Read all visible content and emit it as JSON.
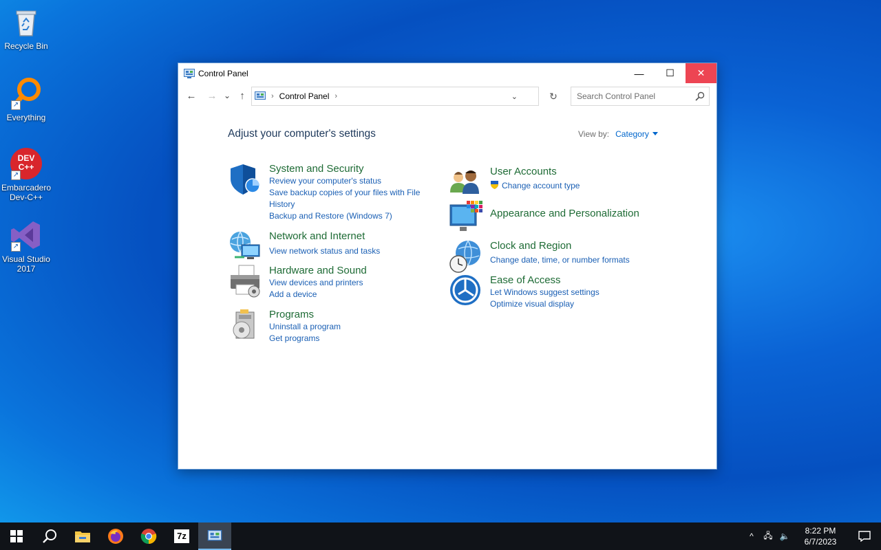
{
  "desktop": {
    "icons": [
      {
        "label": "Recycle Bin"
      },
      {
        "label": "Everything"
      },
      {
        "label": "Embarcadero Dev-C++",
        "badge": "DEV C++"
      },
      {
        "label": "Visual Studio 2017"
      }
    ]
  },
  "window": {
    "title": "Control Panel",
    "controls": {
      "minimize": "—",
      "maximize": "☐",
      "close": "✕"
    },
    "nav": {
      "back": "←",
      "forward": "→",
      "recent": "⌄",
      "up": "↑"
    },
    "address": {
      "crumb": "Control Panel",
      "separator": "›",
      "refresh": "↻",
      "dropdown": "⌄"
    },
    "search": {
      "placeholder": "Search Control Panel"
    },
    "heading": "Adjust your computer's settings",
    "view_by": {
      "label": "View by:",
      "value": "Category"
    },
    "categories": [
      {
        "title": "System and Security",
        "icon": "shield-icon",
        "links": [
          "Review your computer's status",
          "Save backup copies of your files with File History",
          "Backup and Restore (Windows 7)"
        ]
      },
      {
        "title": "Network and Internet",
        "icon": "network-icon",
        "links": [
          "View network status and tasks"
        ]
      },
      {
        "title": "Hardware and Sound",
        "icon": "printer-icon",
        "links": [
          "View devices and printers",
          "Add a device"
        ]
      },
      {
        "title": "Programs",
        "icon": "programs-icon",
        "links": [
          "Uninstall a program",
          "Get programs"
        ]
      },
      {
        "title": "User Accounts",
        "icon": "users-icon",
        "links": [
          "Change account type"
        ]
      },
      {
        "title": "Appearance and Personalization",
        "icon": "monitor-icon",
        "links": []
      },
      {
        "title": "Clock and Region",
        "icon": "clock-globe-icon",
        "links": [
          "Change date, time, or number formats"
        ]
      },
      {
        "title": "Ease of Access",
        "icon": "ease-of-access-icon",
        "links": [
          "Let Windows suggest settings",
          "Optimize visual display"
        ]
      }
    ]
  },
  "taskbar": {
    "apps": [
      "start",
      "search",
      "file-explorer",
      "firefox",
      "chrome",
      "7zip",
      "control-panel"
    ],
    "seven_zip_label": "7z",
    "tray": {
      "chevron": "^",
      "network": "🖧",
      "volume": "🔈"
    },
    "clock": {
      "time": "8:22 PM",
      "date": "6/7/2023"
    }
  },
  "colors": {
    "link": "#1a5fb4",
    "category_title": "#1e6b35",
    "heading": "#1e395b",
    "close_hover": "#e81123"
  }
}
